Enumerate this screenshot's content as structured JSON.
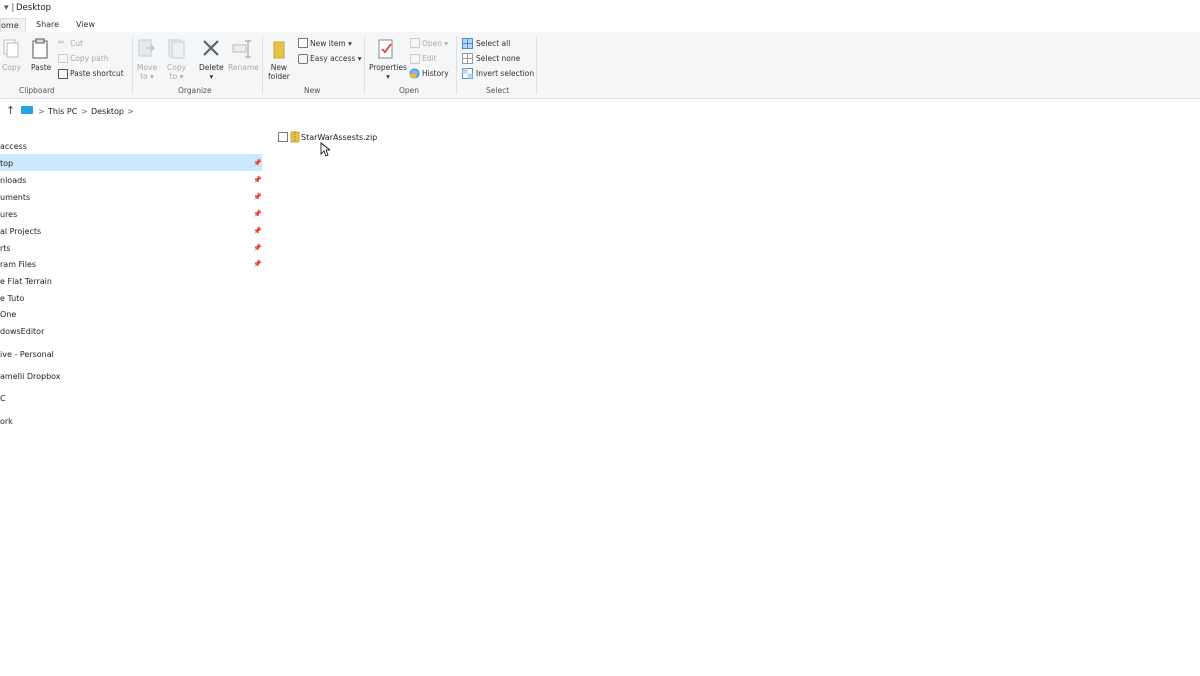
{
  "window": {
    "title": "Desktop"
  },
  "tabs": [
    {
      "label": "ome"
    },
    {
      "label": "Share"
    },
    {
      "label": "View"
    }
  ],
  "ribbon": {
    "clipboard": {
      "copy": "Copy",
      "paste": "Paste",
      "cut": "Cut",
      "copy_path": "Copy path",
      "paste_shortcut": "Paste shortcut",
      "group": "Clipboard"
    },
    "organize": {
      "move_to": "Move\nto",
      "move_label1": "Move",
      "move_label2": "to",
      "copy_label1": "Copy",
      "copy_label2": "to",
      "delete": "Delete",
      "rename": "Rename",
      "group": "Organize"
    },
    "new": {
      "new_folder1": "New",
      "new_folder2": "folder",
      "new_item": "New item",
      "easy_access": "Easy access",
      "group": "New"
    },
    "open": {
      "properties": "Properties",
      "open": "Open",
      "edit": "Edit",
      "history": "History",
      "group": "Open"
    },
    "select": {
      "select_all": "Select all",
      "select_none": "Select none",
      "invert_selection": "Invert selection",
      "group": "Select"
    }
  },
  "address": {
    "this_pc": "This PC",
    "desktop": "Desktop",
    "chevron": ">"
  },
  "sidebar": {
    "items": [
      {
        "label": "access"
      },
      {
        "label": "top"
      },
      {
        "label": "nloads"
      },
      {
        "label": "uments"
      },
      {
        "label": "ures"
      },
      {
        "label": "al Projects"
      },
      {
        "label": "rts"
      },
      {
        "label": "ram Files"
      },
      {
        "label": "e Flat Terrain"
      },
      {
        "label": "e Tuto"
      },
      {
        "label": "One"
      },
      {
        "label": "dowsEditor"
      },
      {
        "label": "ive - Personal"
      },
      {
        "label": "amelli Dropbox"
      },
      {
        "label": "C"
      },
      {
        "label": "ork"
      }
    ]
  },
  "files": [
    {
      "name": "StarWarAssests.zip"
    }
  ],
  "colors": {
    "selection": "#cce8ff",
    "ribbon_bg": "#f5f6f7",
    "folder": "#e8c34a"
  }
}
